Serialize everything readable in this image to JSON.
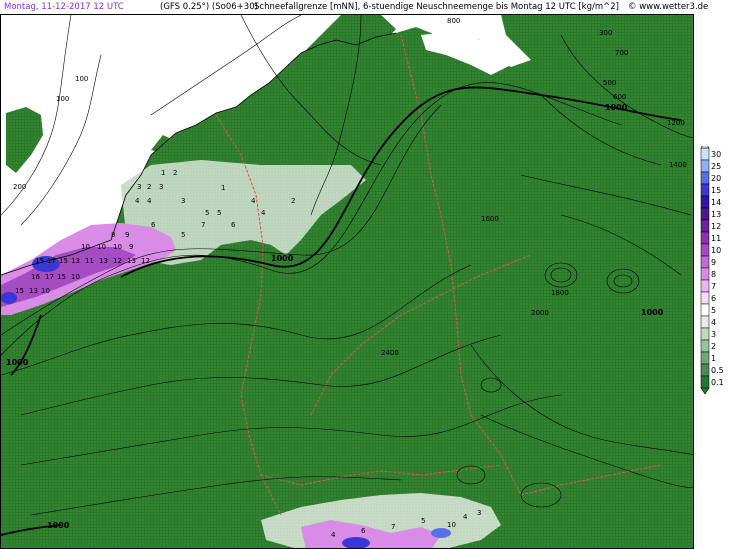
{
  "header": {
    "date_time": "Montag, 11-12-2017  12 UTC",
    "model": "(GFS 0.25°) (So06+30)",
    "description": "Schneefallgrenze [mNN], 6-stuendige Neuschneemenge bis Montag 12 UTC [kg/m^2]",
    "copyright": "© www.wetter3.de"
  },
  "legend": {
    "levels": [
      {
        "label": "30",
        "color": "#c6e6f8"
      },
      {
        "label": "25",
        "color": "#8fb0f2"
      },
      {
        "label": "20",
        "color": "#5a6ee6"
      },
      {
        "label": "15",
        "color": "#3a36d8"
      },
      {
        "label": "14",
        "color": "#2a16a8"
      },
      {
        "label": "13",
        "color": "#4a1a8a"
      },
      {
        "label": "12",
        "color": "#6a2496"
      },
      {
        "label": "11",
        "color": "#8a34aa"
      },
      {
        "label": "10",
        "color": "#a64cc2"
      },
      {
        "label": "9",
        "color": "#c06ad6"
      },
      {
        "label": "8",
        "color": "#d98ce6"
      },
      {
        "label": "7",
        "color": "#ecb4f0"
      },
      {
        "label": "6",
        "color": "#f6dcf6"
      },
      {
        "label": "5",
        "color": "#ffffff"
      },
      {
        "label": "4",
        "color": "#e4eee6"
      },
      {
        "label": "3",
        "color": "#c2d8c6"
      },
      {
        "label": "2",
        "color": "#9cc0a2"
      },
      {
        "label": "1",
        "color": "#72a67c"
      },
      {
        "label": "0.5",
        "color": "#4a8c58"
      },
      {
        "label": "0.1",
        "color": "#247a32"
      }
    ]
  },
  "map": {
    "land_color": "#2a7a2a",
    "sea_color": "#ffffff",
    "contour_labels": [
      "100",
      "100",
      "200",
      "300",
      "500",
      "600",
      "700",
      "800",
      "1000",
      "1000",
      "1000",
      "1000",
      "1000",
      "1200",
      "1400",
      "1600",
      "1800",
      "2000",
      "2400"
    ],
    "snow_values": [
      "1",
      "2",
      "3",
      "4",
      "5",
      "6",
      "7",
      "8",
      "9",
      "10",
      "11",
      "12",
      "13",
      "15",
      "16",
      "17"
    ]
  }
}
